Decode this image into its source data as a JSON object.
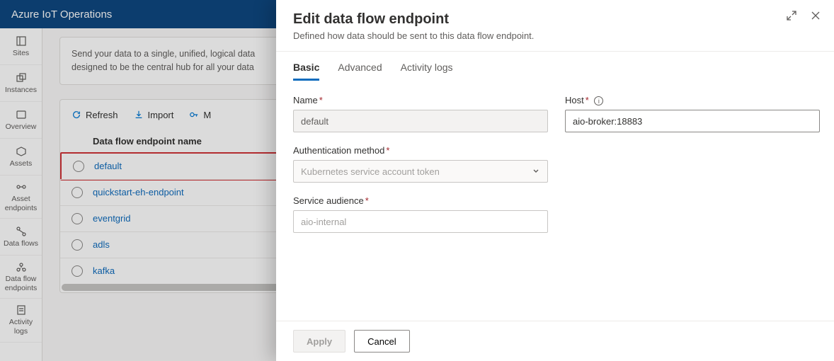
{
  "header": {
    "product": "Azure IoT Operations"
  },
  "sidebar": {
    "items": [
      {
        "label": "Sites"
      },
      {
        "label": "Instances"
      },
      {
        "label": "Overview"
      },
      {
        "label": "Assets"
      },
      {
        "label": "Asset endpoints"
      },
      {
        "label": "Data flows"
      },
      {
        "label": "Data flow endpoints"
      },
      {
        "label": "Activity logs"
      }
    ]
  },
  "info_card": {
    "line1": "Send your data to a single, unified, logical data",
    "line2": "designed to be the central hub for all your data"
  },
  "toolbar": {
    "refresh": "Refresh",
    "import": "Import",
    "more_prefix": "M"
  },
  "table": {
    "header": "Data flow endpoint name",
    "rows": [
      {
        "name": "default",
        "highlight": true
      },
      {
        "name": "quickstart-eh-endpoint"
      },
      {
        "name": "eventgrid"
      },
      {
        "name": "adls"
      },
      {
        "name": "kafka"
      }
    ]
  },
  "panel": {
    "title": "Edit data flow endpoint",
    "subtitle": "Defined how data should be sent to this data flow endpoint.",
    "tabs": {
      "basic": "Basic",
      "advanced": "Advanced",
      "activity": "Activity logs"
    },
    "fields": {
      "name_label": "Name",
      "name_value": "default",
      "host_label": "Host",
      "host_value": "aio-broker:18883",
      "auth_label": "Authentication method",
      "auth_placeholder": "Kubernetes service account token",
      "audience_label": "Service audience",
      "audience_placeholder": "aio-internal"
    },
    "footer": {
      "apply": "Apply",
      "cancel": "Cancel"
    }
  }
}
